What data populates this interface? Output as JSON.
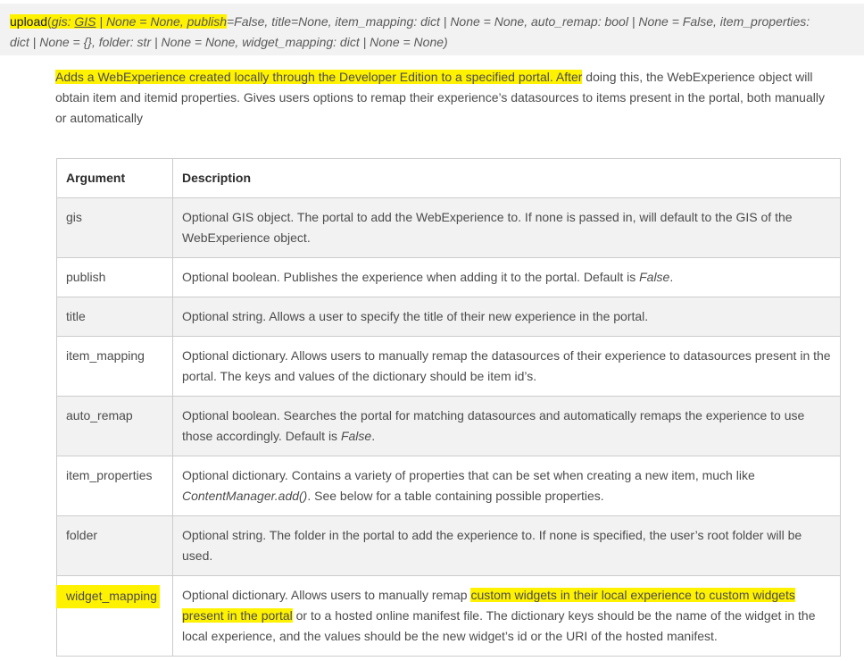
{
  "signature": {
    "fn_name": "upload",
    "open": "(",
    "p1": "gis: ",
    "gis_link": "GIS",
    "p1_rest": " | None = None, ",
    "p2": "publish",
    "p2_rest": "=False, title=None, item_mapping: dict | None = None, auto_remap: bool | None = False, item_properties:",
    "line2": "dict | None = {}, folder: str | None = None, widget_mapping: dict | None = None)"
  },
  "description": {
    "highlighted": "Adds a WebExperience created locally through the Developer Edition to a specified portal. After",
    "rest": " doing this, the WebExperience object will obtain item and itemid properties. Gives users options to remap their experience’s datasources to items present in the portal, both manually or automatically"
  },
  "table": {
    "headers": {
      "argument": "Argument",
      "description": "Description"
    },
    "rows": [
      {
        "arg": "gis",
        "desc": "Optional GIS object. The portal to add the WebExperience to. If none is passed in, will default to the GIS of the WebExperience object."
      },
      {
        "arg": "publish",
        "desc_pre": "Optional boolean. Publishes the experience when adding it to the portal. Default is ",
        "desc_em": "False",
        "desc_post": "."
      },
      {
        "arg": "title",
        "desc": "Optional string. Allows a user to specify the title of their new experience in the portal."
      },
      {
        "arg": "item_mapping",
        "desc": "Optional dictionary. Allows users to manually remap the datasources of their experience to datasources present in the portal. The keys and values of the dictionary should be item id’s."
      },
      {
        "arg": "auto_remap",
        "desc_pre": "Optional boolean. Searches the portal for matching datasources and automatically remaps the experience to use those accordingly. Default is ",
        "desc_em": "False",
        "desc_post": "."
      },
      {
        "arg": "item_properties",
        "desc_pre": "Optional dictionary. Contains a variety of properties that can be set when creating a new item, much like ",
        "desc_em": "ContentManager.add()",
        "desc_post": ". See below for a table containing possible properties."
      },
      {
        "arg": "folder",
        "desc": "Optional string. The folder in the portal to add the experience to. If none is specified, the user’s root folder will be used."
      },
      {
        "arg": "widget_mapping",
        "desc_pre": "Optional dictionary. Allows users to manually remap ",
        "desc_hl": "custom widgets in their local experience to custom widgets present in the portal",
        "desc_post": " or to a hosted online manifest file. The dictionary keys should be the name of the widget in the local experience, and the values should be the new widget’s id or the URI of the hosted manifest."
      }
    ]
  },
  "colors": {
    "highlight": "#fff200",
    "row_shade": "#f2f2f2",
    "border": "#cccccc",
    "text": "#4c4c4c"
  }
}
